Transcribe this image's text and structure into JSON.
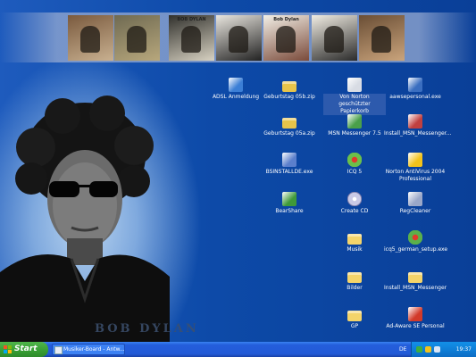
{
  "album_strip": {
    "covers": [
      {
        "name": "cover-1",
        "colors": [
          "#7a5a3e",
          "#c8b090"
        ],
        "title": ""
      },
      {
        "name": "cover-2",
        "colors": [
          "#6f6a52",
          "#b7a77c"
        ],
        "title": ""
      },
      {
        "name": "cover-3",
        "colors": [
          "#30302c",
          "#d8d2c2"
        ],
        "title": "BOB DYLAN"
      },
      {
        "name": "cover-4",
        "colors": [
          "#e9e6df",
          "#222"
        ],
        "title": ""
      },
      {
        "name": "cover-5",
        "colors": [
          "#f2efe6",
          "#7a4a3a"
        ],
        "title": "Bob Dylan"
      },
      {
        "name": "cover-6",
        "colors": [
          "#f1ede3",
          "#2a2a2a"
        ],
        "title": ""
      },
      {
        "name": "cover-7",
        "colors": [
          "#6a4e35",
          "#caa47c"
        ],
        "title": ""
      }
    ]
  },
  "wallpaper": {
    "caption": "BOB DYLAN"
  },
  "desktop_icons": [
    {
      "label": "ADSL Anmeldung",
      "icon": "network-connection-icon",
      "color": "#3c7fd6",
      "selected": false
    },
    {
      "label": "Geburtstag 05b.zip",
      "icon": "zip-folder-icon",
      "color": "#e7c44a",
      "selected": false
    },
    {
      "label": "Von Norton geschützter Papierkorb",
      "icon": "recycle-bin-icon",
      "color": "#d8dce4",
      "selected": true
    },
    {
      "label": "aawsepersonal.exe",
      "icon": "installer-icon",
      "color": "#3a6ec0",
      "selected": false
    },
    {
      "label": "Geburtstag 05a.zip",
      "icon": "zip-folder-icon",
      "color": "#e7c44a",
      "selected": false
    },
    {
      "label": "MSN Messenger 7.5",
      "icon": "msn-messenger-icon",
      "color": "#4aa04a",
      "selected": false
    },
    {
      "label": "Install_MSN_Messenger...",
      "icon": "msn-installer-icon",
      "color": "#c04040",
      "selected": false
    },
    {
      "label": "BSINSTALLDE.exe",
      "icon": "installer-icon",
      "color": "#5b7fcc",
      "selected": false
    },
    {
      "label": "ICQ 5",
      "icon": "icq-flower-icon",
      "color": "#6cc04a",
      "selected": false
    },
    {
      "label": "Norton AntiVirus 2004 Professional",
      "icon": "norton-icon",
      "color": "#f2c21b",
      "selected": false
    },
    {
      "label": "BearShare",
      "icon": "bearshare-icon",
      "color": "#3f9a3a",
      "selected": false
    },
    {
      "label": "Create CD",
      "icon": "create-cd-icon",
      "color": "#c8c8c8",
      "selected": false
    },
    {
      "label": "RegCleaner",
      "icon": "regcleaner-icon",
      "color": "#9aa7c8",
      "selected": false
    },
    {
      "label": "Musik",
      "icon": "folder-icon",
      "color": "#f4d46a",
      "selected": false
    },
    {
      "label": "icq5_german_setup.exe",
      "icon": "icq-setup-icon",
      "color": "#5bb04a",
      "selected": false
    },
    {
      "label": "Bilder",
      "icon": "folder-icon",
      "color": "#f4d46a",
      "selected": false
    },
    {
      "label": "Install_MSN_Messenger",
      "icon": "folder-icon",
      "color": "#f4d46a",
      "selected": false
    },
    {
      "label": "GP",
      "icon": "folder-icon",
      "color": "#f4d46a",
      "selected": false
    },
    {
      "label": "Ad-Aware SE Personal",
      "icon": "ad-aware-icon",
      "color": "#d23a2a",
      "selected": false
    }
  ],
  "taskbar": {
    "start_label": "Start",
    "task_label": "Musiker-Board - Antw...",
    "language": "DE",
    "clock": "19:37"
  }
}
